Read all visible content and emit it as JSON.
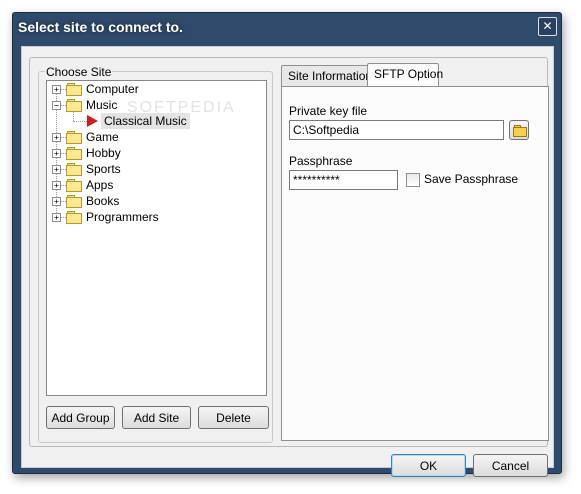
{
  "window": {
    "title": "Select site to connect to.",
    "close_glyph": "✕"
  },
  "choose_site": {
    "label": "Choose Site",
    "tree": [
      {
        "label": "Computer",
        "expander": "+"
      },
      {
        "label": "Music",
        "expander": "−"
      },
      {
        "label": "Classical Music"
      },
      {
        "label": "Game",
        "expander": "+"
      },
      {
        "label": "Hobby",
        "expander": "+"
      },
      {
        "label": "Sports",
        "expander": "+"
      },
      {
        "label": "Apps",
        "expander": "+"
      },
      {
        "label": "Books",
        "expander": "+"
      },
      {
        "label": "Programmers",
        "expander": "+"
      }
    ],
    "buttons": {
      "add_group": "Add Group",
      "add_site": "Add Site",
      "delete": "Delete"
    }
  },
  "tabs": {
    "site_information": "Site Information",
    "sftp_option": "SFTP Option"
  },
  "sftp": {
    "private_key_label": "Private key file",
    "private_key_value": "C:\\Softpedia",
    "passphrase_label": "Passphrase",
    "passphrase_value": "**********",
    "save_passphrase_label": "Save Passphrase"
  },
  "footer": {
    "ok": "OK",
    "cancel": "Cancel"
  },
  "watermark": "SOFTPEDIA",
  "colors": {
    "title_bar": "#2f4a6a",
    "selection_arrow": "#d11c1c",
    "folder": "#fbe892"
  }
}
